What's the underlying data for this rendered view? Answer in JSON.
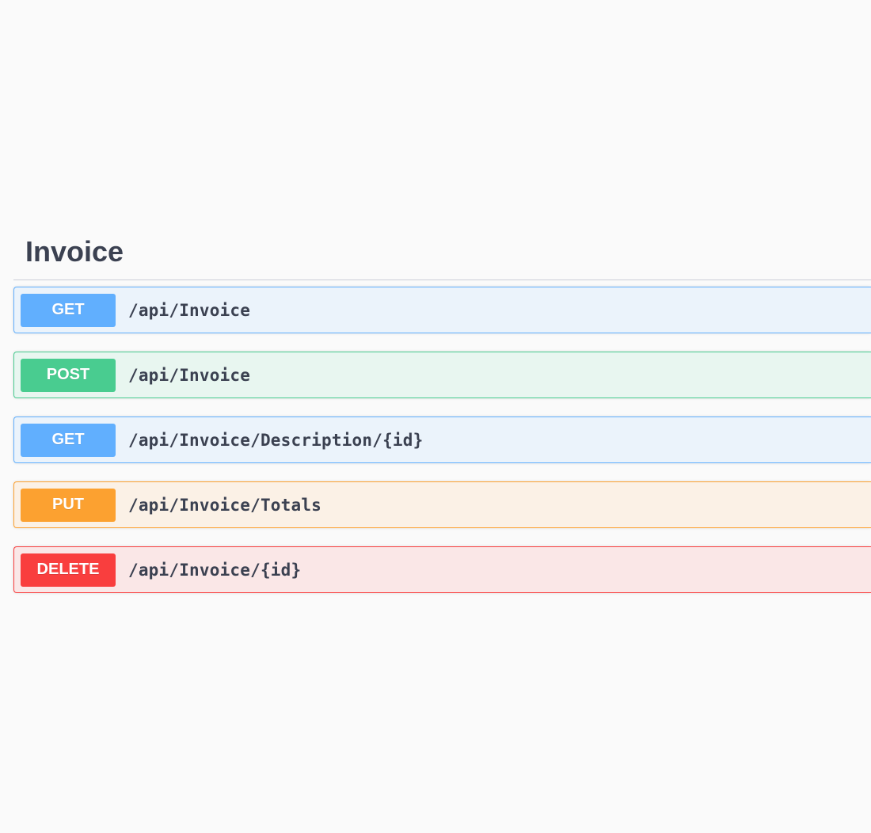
{
  "tag": {
    "title": "Invoice"
  },
  "operations": [
    {
      "method": "GET",
      "path": "/api/Invoice",
      "color": "#61affe"
    },
    {
      "method": "POST",
      "path": "/api/Invoice",
      "color": "#49cc90"
    },
    {
      "method": "GET",
      "path": "/api/Invoice/Description/{id}",
      "color": "#61affe"
    },
    {
      "method": "PUT",
      "path": "/api/Invoice/Totals",
      "color": "#fca130"
    },
    {
      "method": "DELETE",
      "path": "/api/Invoice/{id}",
      "color": "#f93e3e"
    }
  ]
}
